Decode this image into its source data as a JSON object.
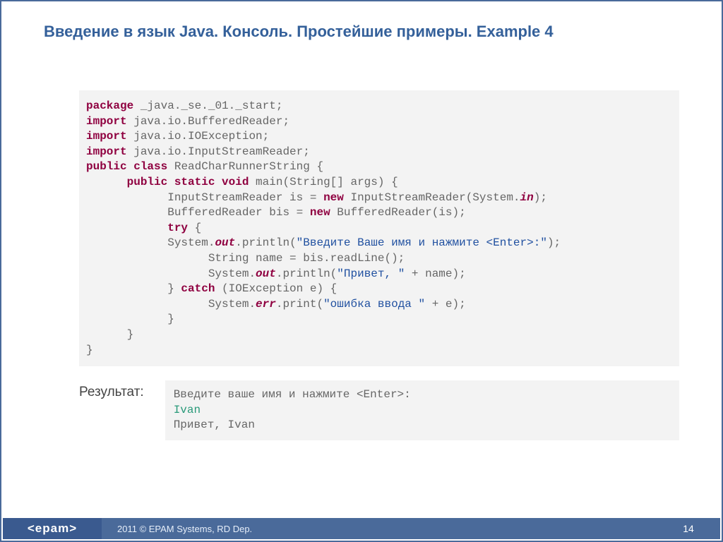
{
  "title": "Введение в язык Java. Консоль. Простейшие примеры. Example 4",
  "code": {
    "kw_package": "package",
    "pkg_name": " _java._se._01._start;",
    "kw_import": "import",
    "imp1": " java.io.BufferedReader;",
    "imp2": " java.io.IOException;",
    "imp3": " java.io.InputStreamReader;",
    "kw_public": "public",
    "kw_class": "class",
    "class_decl": " ReadCharRunnerString {",
    "kw_static": "static",
    "kw_void": "void",
    "main_sig": " main(String[] args) {",
    "line_isr_a": "            InputStreamReader is = ",
    "kw_new": "new",
    "line_isr_b": " InputStreamReader(System.",
    "fld_in": "in",
    "paren_close_semi": ");",
    "line_br_a": "            BufferedReader bis = ",
    "line_br_b": " BufferedReader(is);",
    "kw_try": "try",
    "brace_open": " {",
    "sys_pre": "            System.",
    "fld_out": "out",
    "println_open": ".println(",
    "str_prompt": "\"Введите Ваше имя и нажмите <Enter>:\"",
    "line_readline": "                  String name = bis.readLine();",
    "sys_pre2": "                  System.",
    "str_hello": "\"Привет, \"",
    "plus_name": " + name);",
    "close_try": "            } ",
    "kw_catch": "catch",
    "catch_sig": " (IOException e) {",
    "sys_pre3": "                  System.",
    "fld_err": "err",
    "print_open": ".print(",
    "str_err": "\"ошибка ввода \"",
    "plus_e": " + e);",
    "brace_close1": "            }",
    "brace_close2": "      }",
    "brace_close3": "}"
  },
  "result_label": "Результат:",
  "result": {
    "line1": "Введите ваше имя и нажмите <Enter>:",
    "line2": "Ivan",
    "line3": "Привет, Ivan"
  },
  "footer": {
    "logo": "<epam>",
    "copyright": "2011 © EPAM Systems, RD Dep.",
    "page": "14"
  }
}
